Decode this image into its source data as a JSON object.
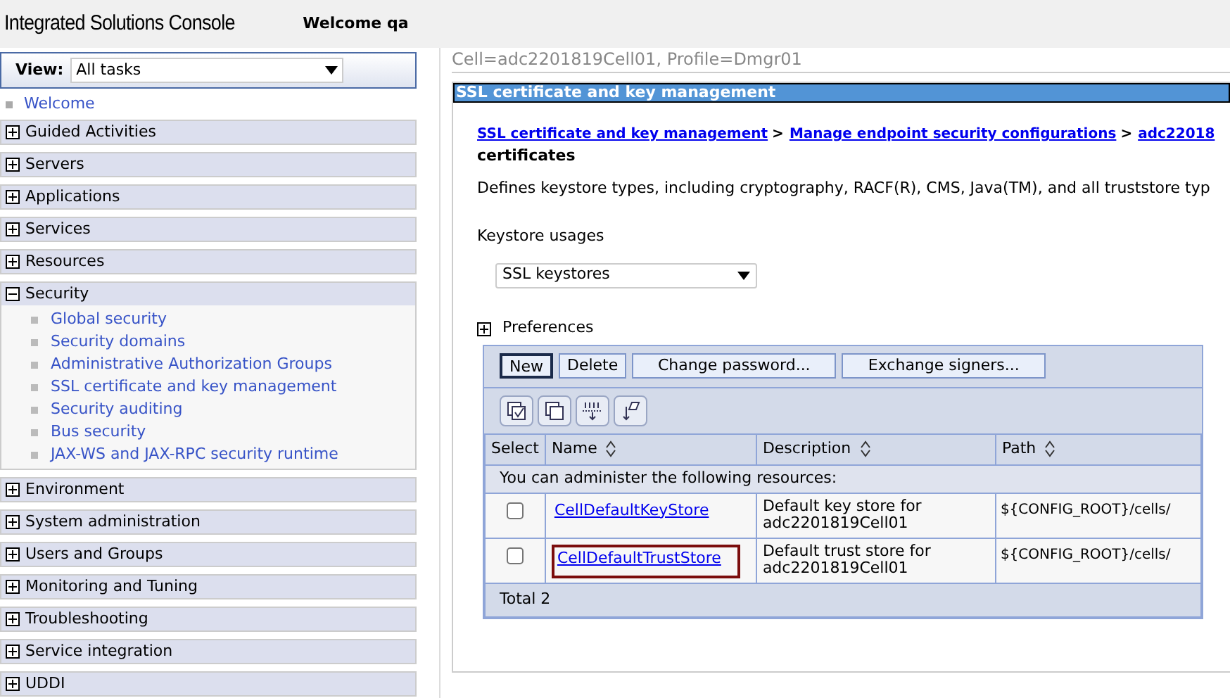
{
  "header": {
    "title": "Integrated Solutions Console",
    "welcome": "Welcome qa"
  },
  "sidebar": {
    "view_label": "View:",
    "view_value": "All tasks",
    "welcome": "Welcome",
    "sections": [
      {
        "label": "Guided Activities",
        "expanded": false
      },
      {
        "label": "Servers",
        "expanded": false
      },
      {
        "label": "Applications",
        "expanded": false
      },
      {
        "label": "Services",
        "expanded": false
      },
      {
        "label": "Resources",
        "expanded": false
      },
      {
        "label": "Security",
        "expanded": true,
        "children": [
          "Global security",
          "Security domains",
          "Administrative Authorization Groups",
          "SSL certificate and key management",
          "Security auditing",
          "Bus security",
          "JAX-WS and JAX-RPC security runtime"
        ]
      },
      {
        "label": "Environment",
        "expanded": false
      },
      {
        "label": "System administration",
        "expanded": false
      },
      {
        "label": "Users and Groups",
        "expanded": false
      },
      {
        "label": "Monitoring and Tuning",
        "expanded": false
      },
      {
        "label": "Troubleshooting",
        "expanded": false
      },
      {
        "label": "Service integration",
        "expanded": false
      },
      {
        "label": "UDDI",
        "expanded": false
      }
    ]
  },
  "main": {
    "scope": "Cell=adc2201819Cell01, Profile=Dmgr01",
    "panel_title": "SSL certificate and key management",
    "breadcrumb": [
      "SSL certificate and key management",
      "Manage endpoint security configurations",
      "adc22018"
    ],
    "separator": ">",
    "page_title": "certificates",
    "description": "Defines keystore types, including cryptography, RACF(R), CMS, Java(TM), and all truststore typ",
    "usage_label": "Keystore usages",
    "usage_value": "SSL keystores",
    "preferences": "Preferences",
    "preferences_expanded": false,
    "buttons": [
      {
        "label": "New",
        "focused": true
      },
      {
        "label": "Delete",
        "focused": false
      },
      {
        "label": "Change password...",
        "focused": false
      },
      {
        "label": "Exchange signers...",
        "focused": false
      }
    ],
    "table": {
      "columns": [
        "Select",
        "Name",
        "Description",
        "Path"
      ],
      "group_row": "You can administer the following resources:",
      "rows": [
        {
          "checked": false,
          "name": "CellDefaultKeyStore",
          "description": "Default key store for adc2201819Cell01",
          "path": "${CONFIG_ROOT}/cells/",
          "highlighted": false
        },
        {
          "checked": false,
          "name": "CellDefaultTrustStore",
          "description": "Default trust store for adc2201819Cell01",
          "path": "${CONFIG_ROOT}/cells/",
          "highlighted": true
        }
      ],
      "total": "Total 2"
    }
  }
}
